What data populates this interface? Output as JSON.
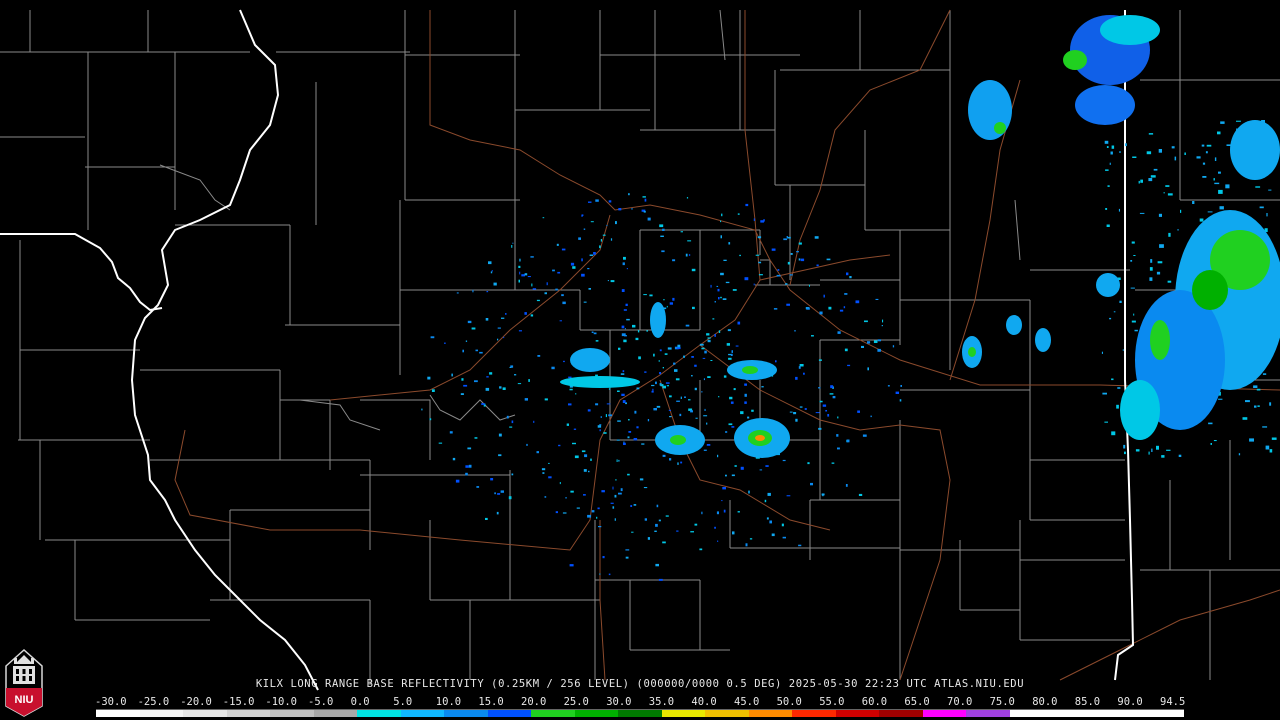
{
  "caption": "KILX LONG RANGE BASE REFLECTIVITY (0.25KM / 256 LEVEL) (000000/0000 0.5 DEG) 2025-05-30 22:23 UTC  ATLAS.NIU.EDU",
  "logo_text": "NIU",
  "scale": {
    "labels": [
      "-30.0",
      "-25.0",
      "-20.0",
      "-15.0",
      "-10.0",
      "-5.0",
      "0.0",
      "5.0",
      "10.0",
      "15.0",
      "20.0",
      "25.0",
      "30.0",
      "35.0",
      "40.0",
      "45.0",
      "50.0",
      "55.0",
      "60.0",
      "65.0",
      "70.0",
      "75.0",
      "80.0",
      "85.0",
      "90.0",
      "94.5"
    ],
    "colors": [
      "#ffffff",
      "#f4f4f4",
      "#e6e6e6",
      "#d2d2d2",
      "#c0c0c0",
      "#a8a8a8",
      "#00e2e2",
      "#10b8ff",
      "#0a8af0",
      "#0050ff",
      "#20d020",
      "#00b000",
      "#007a00",
      "#e8e800",
      "#f0c000",
      "#ff8c00",
      "#ff2800",
      "#d00000",
      "#a00000",
      "#ff00ff",
      "#a040e0",
      "#ffffff",
      "#ffffff",
      "#ffffff",
      "#ffffff"
    ]
  },
  "colors": {
    "background": "#000000",
    "county_lines": "#8a8a8a",
    "state_lines": "#ffffff",
    "roads": "#8b4a2c"
  }
}
